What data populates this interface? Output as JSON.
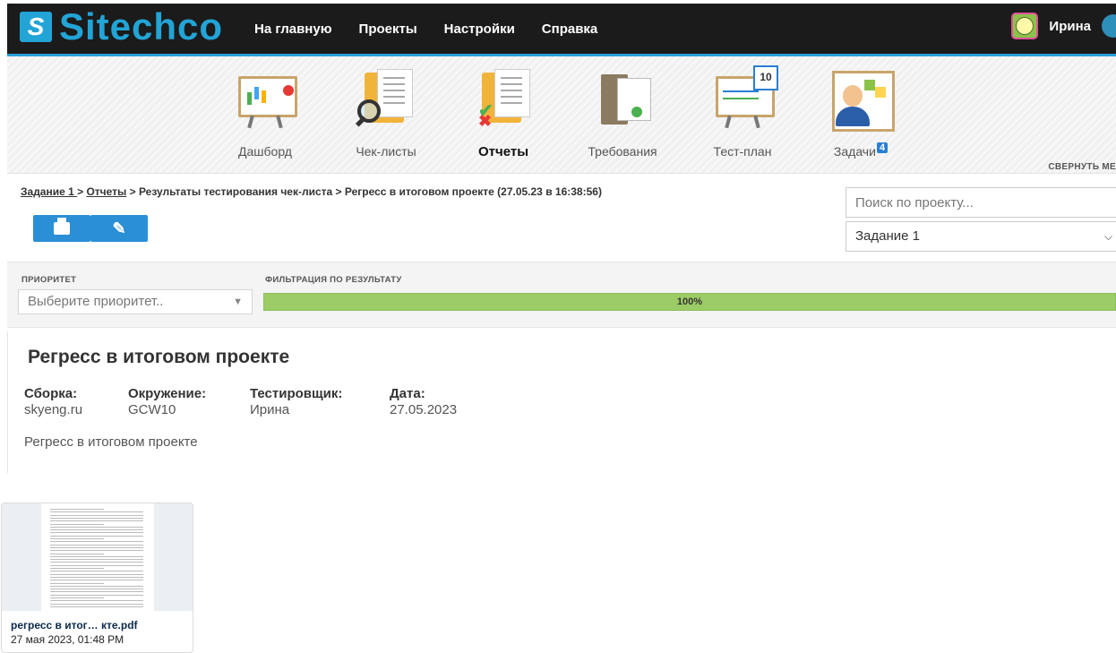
{
  "brand": {
    "logo_mark": "S",
    "name": "Sitechco"
  },
  "nav": [
    "На главную",
    "Проекты",
    "Настройки",
    "Справка"
  ],
  "user": {
    "name": "Ирина"
  },
  "modules": {
    "items": [
      {
        "label": "Дашборд"
      },
      {
        "label": "Чек-листы"
      },
      {
        "label": "Отчеты"
      },
      {
        "label": "Требования"
      },
      {
        "label": "Тест-план"
      },
      {
        "label": "Задачи",
        "badge": "4"
      }
    ],
    "calendar_day": "10",
    "collapse_label": "СВЕРНУТЬ МЕ"
  },
  "breadcrumb": {
    "link1": "Задание 1 ",
    "sep": " > ",
    "link2": "Отчеты",
    "rest": " > Результаты тестирования чек-листа > Регресс в итоговом проекте (27.05.23 в 16:38:56)"
  },
  "search": {
    "placeholder": "Поиск по проекту..."
  },
  "project_select": {
    "value": "Задание 1"
  },
  "filters": {
    "priority_label": "ПРИОРИТЕТ",
    "priority_placeholder": "Выберите приоритет..",
    "result_label": "ФИЛЬТРАЦИЯ ПО РЕЗУЛЬТАТУ",
    "progress_text": "100%",
    "progress_value": 1.0
  },
  "report": {
    "title": "Регресс в итоговом проекте",
    "fields": [
      {
        "key": "Сборка:",
        "value": "skyeng.ru"
      },
      {
        "key": "Окружение:",
        "value": "GCW10"
      },
      {
        "key": "Тестировщик:",
        "value": "Ирина"
      },
      {
        "key": "Дата:",
        "value": "27.05.2023"
      }
    ],
    "description": "Регресс в итоговом проекте"
  },
  "attachment": {
    "filename": "регресс в итог… кте.pdf",
    "date": "27 мая 2023, 01:48 PM"
  },
  "colors": {
    "accent": "#2aa0d8",
    "topbar": "#1b1b1b",
    "progress": "#9ccc65",
    "button": "#2a8fd4"
  }
}
